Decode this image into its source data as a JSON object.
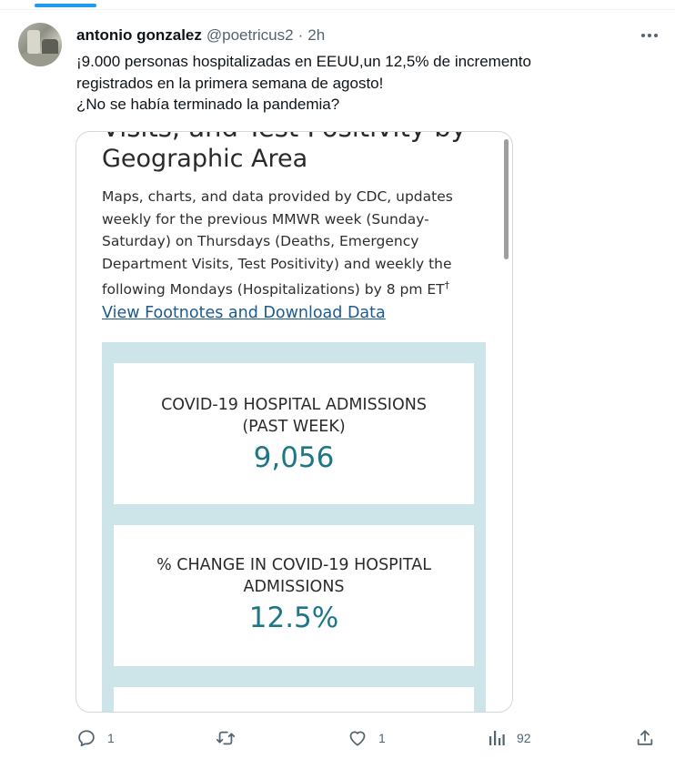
{
  "tweet": {
    "display_name": "antonio gonzalez",
    "handle": "@poetricus2",
    "separator": "·",
    "time": "2h",
    "more_icon": "more-horizontal-icon",
    "text_lines": [
      "¡9.000 personas hospitalizadas en EEUU,un 12,5% de incremento",
      "registrados en la primera semana de agosto!",
      "¿No se había terminado la pandemia?"
    ]
  },
  "media": {
    "cut_heading": "Visits, and Test Positivity by",
    "heading": "Geographic Area",
    "description_lines": [
      "Maps, charts, and data provided by CDC, updates",
      "weekly for the previous MMWR week (Sunday-",
      "Saturday) on Thursdays (Deaths, Emergency",
      "Department Visits, Test Positivity) and weekly the",
      "following Mondays (Hospitalizations) by 8 pm ET"
    ],
    "dagger": "†",
    "footnotes_link": "View Footnotes and Download Data",
    "stats": [
      {
        "title_line1": "COVID-19 HOSPITAL ADMISSIONS",
        "title_line2": "(PAST WEEK)",
        "value": "9,056"
      },
      {
        "title_line1": "% CHANGE IN COVID-19 HOSPITAL",
        "title_line2": "ADMISSIONS",
        "value": "12.5%"
      }
    ]
  },
  "actions": {
    "reply": {
      "icon": "reply-icon",
      "count": "1"
    },
    "retweet": {
      "icon": "retweet-icon",
      "count": ""
    },
    "like": {
      "icon": "heart-icon",
      "count": "1"
    },
    "views": {
      "icon": "analytics-icon",
      "count": "92"
    },
    "share": {
      "icon": "share-icon"
    }
  },
  "colors": {
    "accent": "#1d9bf0",
    "muted_text": "#536471",
    "stat_value": "#1d7786",
    "stat_background": "#cde5e8",
    "link": "#1c5a8f"
  }
}
